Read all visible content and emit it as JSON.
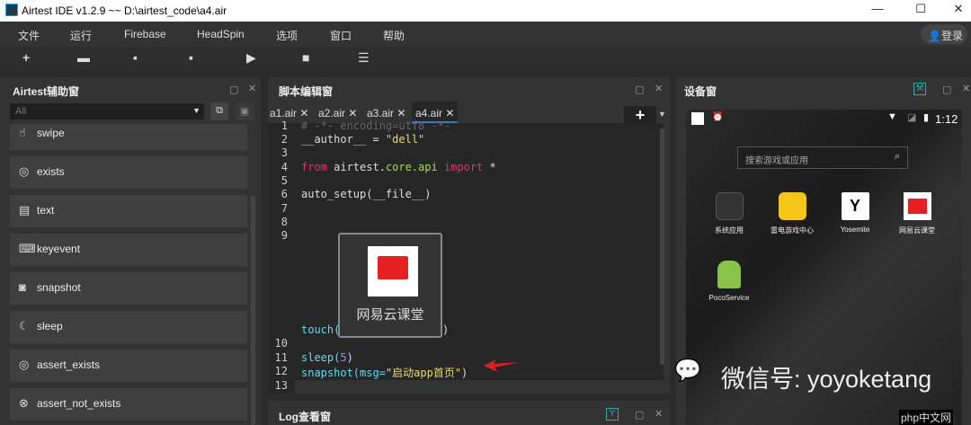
{
  "window": {
    "title": "Airtest IDE v1.2.9 ~~ D:\\airtest_code\\a4.air",
    "min": "—",
    "max": "☐",
    "close": "✕"
  },
  "menu": [
    "文件",
    "运行",
    "Firebase",
    "HeadSpin",
    "选项",
    "窗口",
    "帮助"
  ],
  "login": "登录",
  "left_panel": {
    "title": "Airtest辅助窗",
    "filter": "All",
    "items": [
      "swipe",
      "exists",
      "text",
      "keyevent",
      "snapshot",
      "sleep",
      "assert_exists",
      "assert_not_exists"
    ]
  },
  "editor": {
    "title": "脚本编辑窗",
    "tabs": [
      "a1.air",
      "a2.air",
      "a3.air",
      "a4.air"
    ],
    "active_tab": "a4.air",
    "lines": {
      "n1": "1",
      "c1": "# -*- encoding=utf8 -*-",
      "n2": "2",
      "c2a": "__author__ = ",
      "c2b": "\"dell\"",
      "n3": "3",
      "n4": "4",
      "c4a": "from",
      "c4b": " airtest.",
      "c4c": "core.api",
      "c4d": " import",
      "c4e": " *",
      "n5": "5",
      "n6": "6",
      "c6": "auto_setup(__file__)",
      "n7": "7",
      "n8": "8",
      "n9": "9",
      "touch": "touch(",
      "touch_end": ")",
      "thumb_label": "网易云课堂",
      "n10": "10",
      "n11": "11",
      "c11a": "sleep(",
      "c11b": "5",
      "c11c": ")",
      "n12": "12",
      "c12a": "snapshot(msg=",
      "c12b": "\"启动app首页\"",
      "c12c": ")",
      "n13": "13"
    }
  },
  "log_panel": {
    "title": "Log查看窗"
  },
  "device": {
    "title": "设备窗",
    "time": "1:12",
    "search_placeholder": "搜索游戏或应用",
    "apps": [
      "系统应用",
      "雷电游戏中心",
      "Yosemite",
      "网易云课堂",
      "PocoService"
    ]
  },
  "watermark": {
    "text": "微信号: yoyoketang",
    "site": "php中文网"
  }
}
